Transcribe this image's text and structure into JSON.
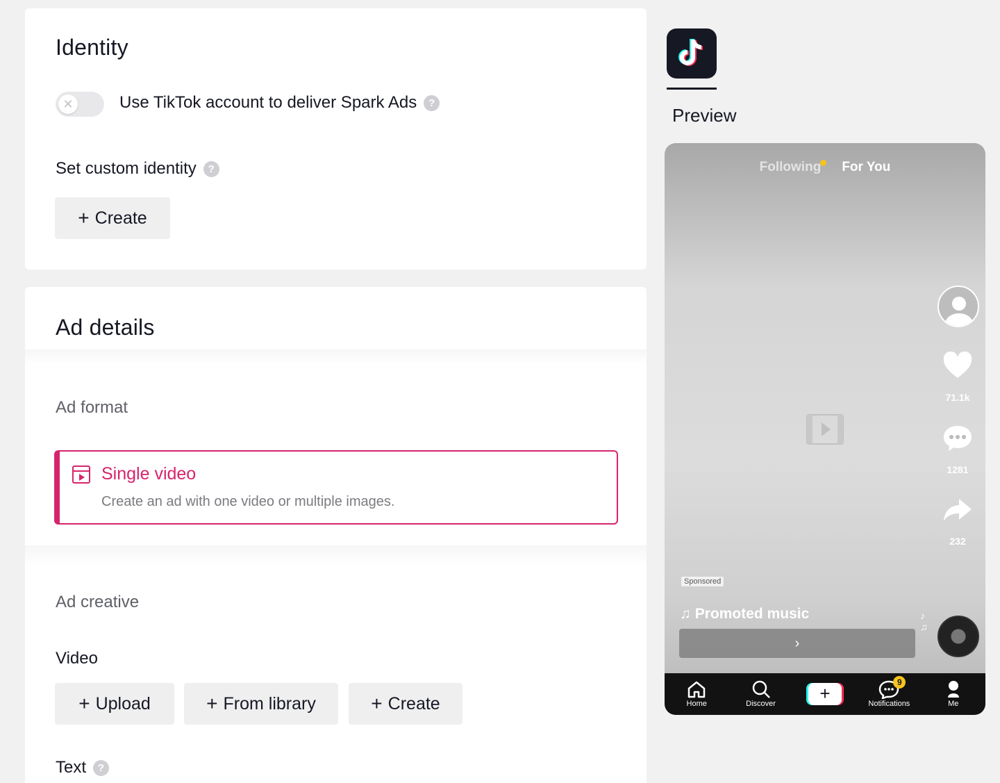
{
  "identity": {
    "title": "Identity",
    "toggle_label": "Use TikTok account to deliver Spark Ads",
    "toggle_on": false,
    "custom_identity_label": "Set custom identity",
    "create_label": "Create"
  },
  "ad_details": {
    "title": "Ad details",
    "ad_format_label": "Ad format",
    "format": {
      "title": "Single video",
      "description": "Create an ad with one video or multiple images."
    },
    "ad_creative_label": "Ad creative",
    "video_label": "Video",
    "buttons": {
      "upload": "Upload",
      "from_library": "From library",
      "create": "Create"
    },
    "text_label": "Text"
  },
  "preview": {
    "label": "Preview",
    "tabs": {
      "following": "Following",
      "for_you": "For You"
    },
    "likes": "71.1k",
    "comments": "1281",
    "shares": "232",
    "sponsored": "Sponsored",
    "music": "Promoted music",
    "cta_arrow": "›",
    "nav": {
      "home": "Home",
      "discover": "Discover",
      "notifications": "Notifications",
      "notifications_badge": "9",
      "me": "Me"
    }
  },
  "colors": {
    "accent": "#d6246b",
    "text": "#161823"
  }
}
